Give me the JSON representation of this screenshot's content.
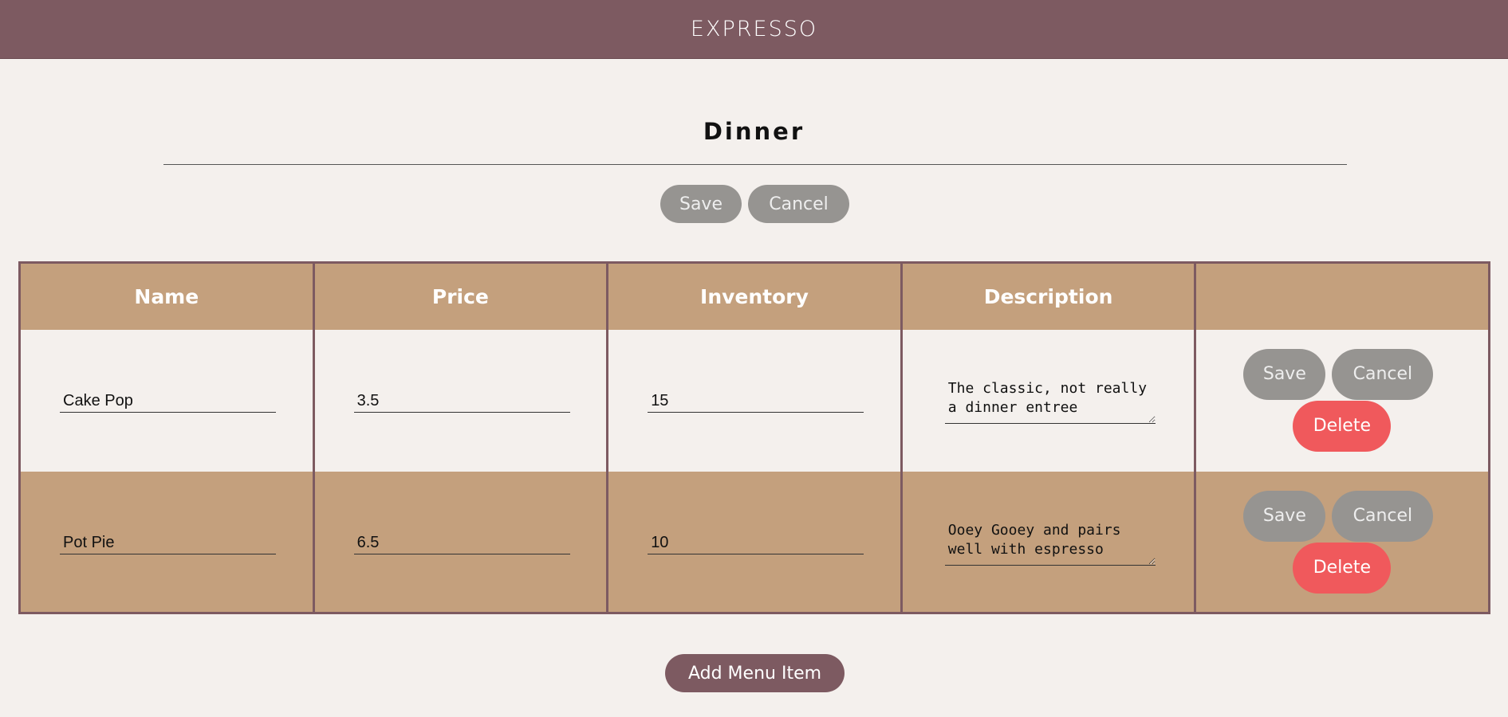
{
  "header": {
    "brand": "EXPRESSO"
  },
  "page": {
    "title": "Dinner",
    "save_label": "Save",
    "cancel_label": "Cancel",
    "add_label": "Add Menu Item"
  },
  "table": {
    "columns": [
      "Name",
      "Price",
      "Inventory",
      "Description",
      ""
    ],
    "rows": [
      {
        "name": "Cake Pop",
        "price": "3.5",
        "inventory": "15",
        "description": "The classic, not really a dinner entree",
        "save_label": "Save",
        "cancel_label": "Cancel",
        "delete_label": "Delete"
      },
      {
        "name": "Pot Pie",
        "price": "6.5",
        "inventory": "10",
        "description": "Ooey Gooey and pairs well with espresso",
        "save_label": "Save",
        "cancel_label": "Cancel",
        "delete_label": "Delete"
      }
    ]
  },
  "colors": {
    "header_bg": "#7d5a61",
    "table_header_bg": "#c4a07d",
    "button_gray": "#969491",
    "button_delete": "#f0595c",
    "page_bg": "#f4f0ed"
  }
}
